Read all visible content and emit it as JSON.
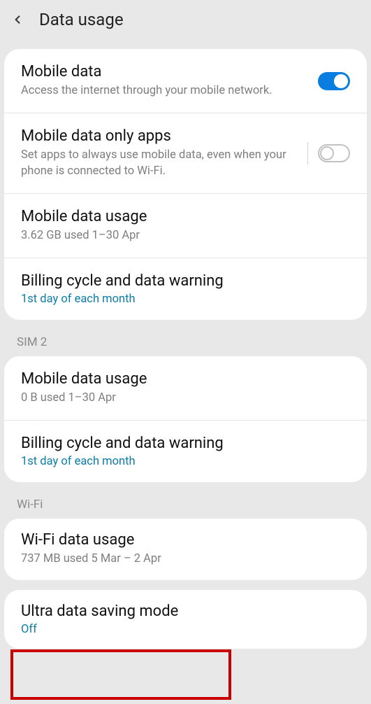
{
  "header": {
    "title": "Data usage"
  },
  "sections": {
    "main": {
      "mobile_data": {
        "title": "Mobile data",
        "subtitle": "Access the internet through your mobile network.",
        "toggle_on": true
      },
      "mobile_data_only_apps": {
        "title": "Mobile data only apps",
        "subtitle": "Set apps to always use mobile data, even when your phone is connected to Wi-Fi.",
        "toggle_on": false
      },
      "mobile_data_usage": {
        "title": "Mobile data usage",
        "subtitle": "3.62 GB used 1–30 Apr"
      },
      "billing_cycle": {
        "title": "Billing cycle and data warning",
        "subtitle": "1st day of each month"
      }
    },
    "sim2": {
      "header": "SIM 2",
      "mobile_data_usage": {
        "title": "Mobile data usage",
        "subtitle": "0 B used 1–30 Apr"
      },
      "billing_cycle": {
        "title": "Billing cycle and data warning",
        "subtitle": "1st day of each month"
      }
    },
    "wifi": {
      "header": "Wi-Fi",
      "wifi_data_usage": {
        "title": "Wi-Fi data usage",
        "subtitle": "737 MB used 5 Mar – 2 Apr"
      }
    },
    "ultra": {
      "title": "Ultra data saving mode",
      "subtitle": "Off"
    }
  }
}
